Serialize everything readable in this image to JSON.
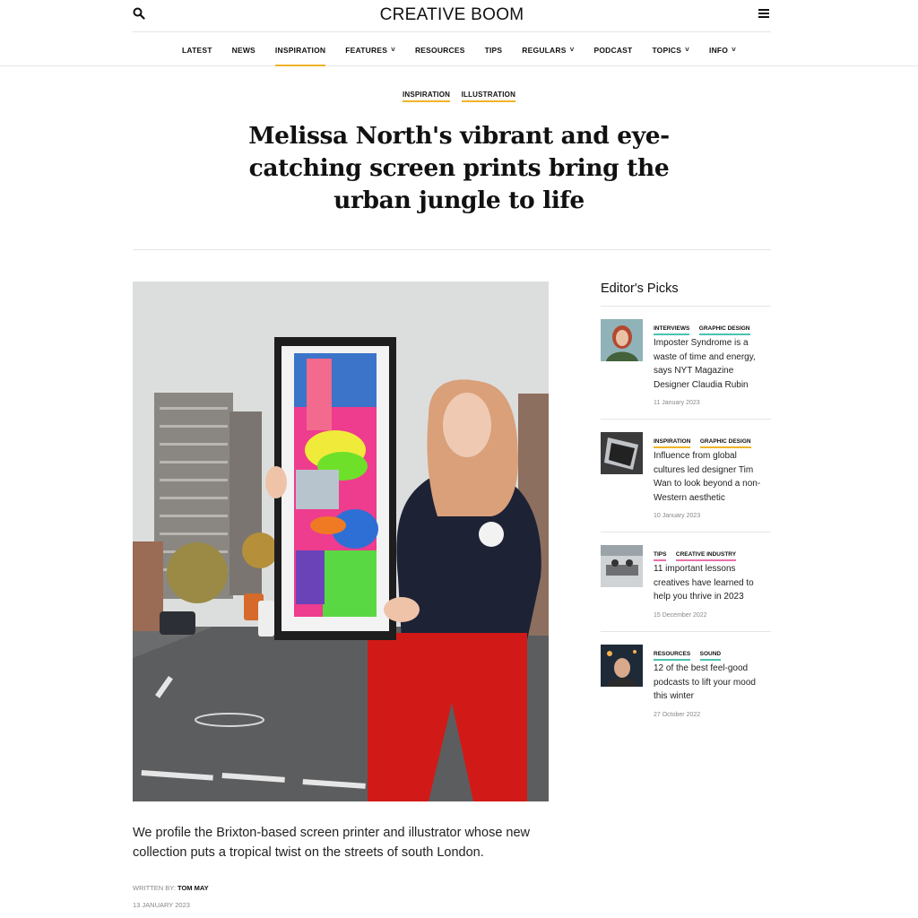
{
  "header": {
    "logo": "CREATIVE BOOM",
    "nav": [
      {
        "label": "LATEST",
        "dropdown": false,
        "active": false
      },
      {
        "label": "NEWS",
        "dropdown": false,
        "active": false
      },
      {
        "label": "INSPIRATION",
        "dropdown": false,
        "active": true
      },
      {
        "label": "FEATURES",
        "dropdown": true,
        "active": false
      },
      {
        "label": "RESOURCES",
        "dropdown": false,
        "active": false
      },
      {
        "label": "TIPS",
        "dropdown": false,
        "active": false
      },
      {
        "label": "REGULARS",
        "dropdown": true,
        "active": false
      },
      {
        "label": "PODCAST",
        "dropdown": false,
        "active": false
      },
      {
        "label": "TOPICS",
        "dropdown": true,
        "active": false
      },
      {
        "label": "INFO",
        "dropdown": true,
        "active": false
      }
    ]
  },
  "article": {
    "tags": [
      "INSPIRATION",
      "ILLUSTRATION"
    ],
    "title": "Melissa North's vibrant and eye-catching screen prints bring the urban jungle to life",
    "dek": "We profile the Brixton-based screen printer and illustrator whose new collection puts a tropical twist on the streets of south London.",
    "byline_prefix": "WRITTEN BY:",
    "author": "TOM MAY",
    "date": "13 JANUARY 2023"
  },
  "sidebar": {
    "heading": "Editor's Picks",
    "picks": [
      {
        "tags": [
          "INTERVIEWS",
          "GRAPHIC DESIGN"
        ],
        "title": "Imposter Syndrome is a waste of time and energy, says NYT Magazine Designer Claudia Rubin",
        "date": "11 January 2023"
      },
      {
        "tags": [
          "INSPIRATION",
          "GRAPHIC DESIGN"
        ],
        "title": "Influence from global cultures led designer Tim Wan to look beyond a non-Western aesthetic",
        "date": "10 January 2023"
      },
      {
        "tags": [
          "TIPS",
          "CREATIVE INDUSTRY"
        ],
        "title": "11 important lessons creatives have learned to help you thrive in 2023",
        "date": "15 December 2022"
      },
      {
        "tags": [
          "RESOURCES",
          "SOUND"
        ],
        "title": "12 of the best feel-good podcasts to lift your mood this winter",
        "date": "27 October 2022"
      }
    ]
  },
  "colors": {
    "accent_yellow": "#f0b429",
    "accent_teal": "#4cc3b0",
    "accent_pink": "#ec6fa8"
  },
  "icons": {
    "search": "search-icon",
    "menu": "hamburger-menu-icon",
    "dropdown": "chevron-down-icon"
  }
}
